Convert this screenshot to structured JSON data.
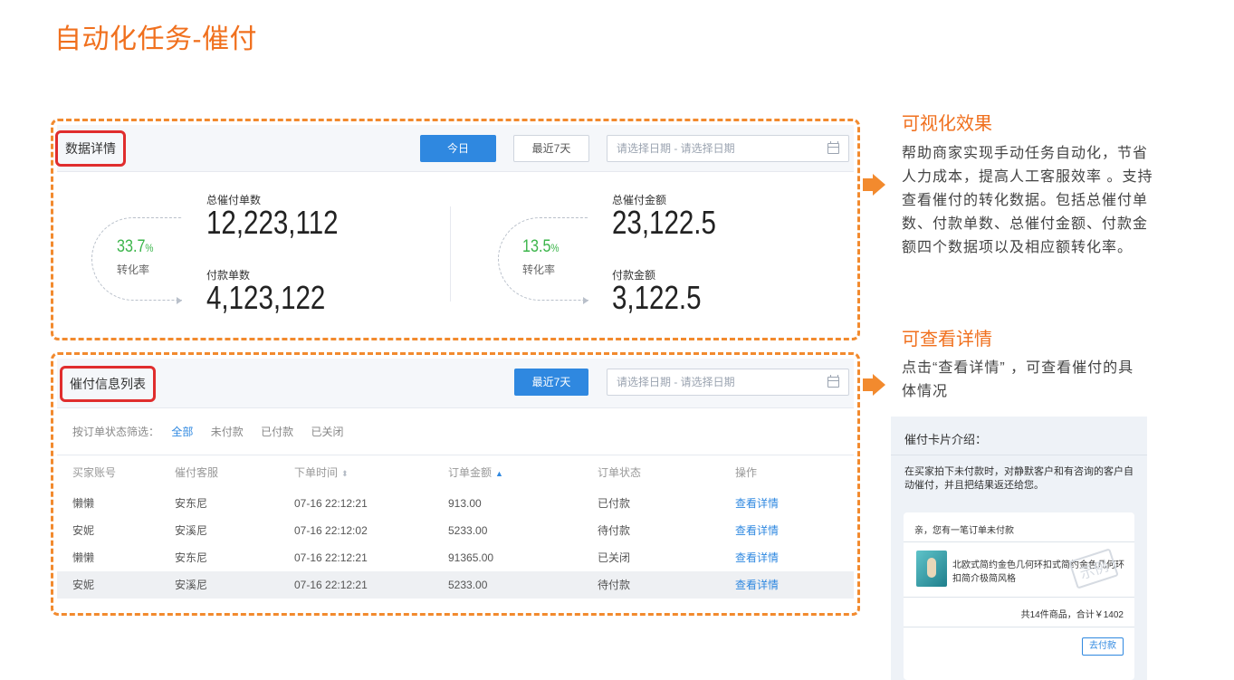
{
  "page": {
    "title": "自动化任务-催付"
  },
  "data_panel": {
    "title": "数据详情",
    "today_button": "今日",
    "last7_button": "最近7天",
    "date_placeholder": "请选择日期 - 请选择日期",
    "left": {
      "rate": "33.7",
      "rate_unit": "%",
      "rate_label": "转化率",
      "top_label": "总催付单数",
      "top_value": "12,223,112",
      "bottom_label": "付款单数",
      "bottom_value": "4,123,122"
    },
    "right": {
      "rate": "13.5",
      "rate_unit": "%",
      "rate_label": "转化率",
      "top_label": "总催付金额",
      "top_value": "23,122.5",
      "bottom_label": "付款金额",
      "bottom_value": "3,122.5"
    }
  },
  "list_panel": {
    "title": "催付信息列表",
    "last7_button": "最近7天",
    "date_placeholder": "请选择日期 - 请选择日期",
    "filter": {
      "label": "按订单状态筛选：",
      "options": [
        "全部",
        "未付款",
        "已付款",
        "已关闭"
      ],
      "active": "全部"
    },
    "columns": [
      "买家账号",
      "催付客服",
      "下单时间",
      "订单金额",
      "订单状态",
      "操作"
    ],
    "rows": [
      {
        "buyer": "懒懒",
        "agent": "安东尼",
        "time": "07-16 22:12:21",
        "amount": "913.00",
        "status": "已付款",
        "action": "查看详情"
      },
      {
        "buyer": "安妮",
        "agent": "安溪尼",
        "time": "07-16 22:12:02",
        "amount": "5233.00",
        "status": "待付款",
        "action": "查看详情"
      },
      {
        "buyer": "懒懒",
        "agent": "安东尼",
        "time": "07-16 22:12:21",
        "amount": "91365.00",
        "status": "已关闭",
        "action": "查看详情"
      },
      {
        "buyer": "安妮",
        "agent": "安溪尼",
        "time": "07-16 22:12:21",
        "amount": "5233.00",
        "status": "待付款",
        "action": "查看详情"
      }
    ]
  },
  "side": {
    "section1_title": "可视化效果",
    "section1_text": "帮助商家实现手动任务自动化，节省人力成本，提高人工客服效率 。支持查看催付的转化数据。包括总催付单数、付款单数、总催付金额、付款金额四个数据项以及相应额转化率。",
    "section2_title": "可查看详情",
    "section2_text": "点击“查看详情” ，可查看催付的具体情况"
  },
  "card": {
    "title": "催付卡片介绍：",
    "desc": "在买家拍下未付款时，对静默客户和有咨询的客户自动催付，并且把结果返还给您。",
    "message": "亲，您有一笔订单未付款",
    "product_name": "北欧式简约金色几何环扣式简约金色几何环扣简介极简风格",
    "stamp": "示例",
    "total": "共14件商品，合计￥1402",
    "pay_button": "去付款"
  },
  "colors": {
    "accent_orange": "#f0701e",
    "primary_blue": "#2f88e0",
    "rate_green": "#3bb54a",
    "highlight_red": "#e02d2d"
  }
}
